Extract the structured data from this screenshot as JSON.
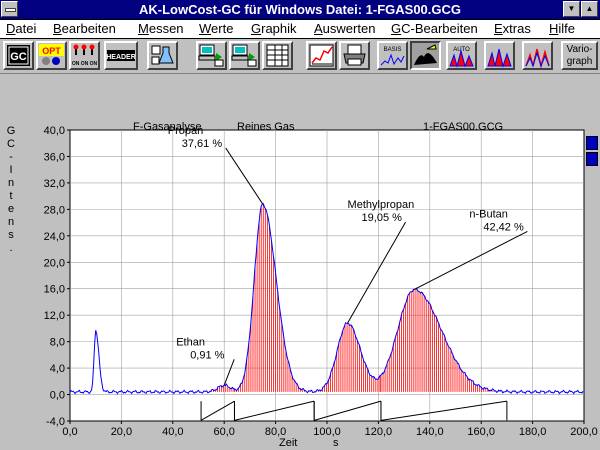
{
  "window": {
    "title": "AK-LowCost-GC für Windows         Datei: 1-FGAS00.GCG",
    "minimize_glyph": "▼",
    "maximize_glyph": "▲"
  },
  "menu": [
    {
      "u": "D",
      "rest": "atei"
    },
    {
      "u": "B",
      "rest": "earbeiten"
    },
    {
      "u": "M",
      "rest": "essen"
    },
    {
      "u": "W",
      "rest": "erte"
    },
    {
      "u": "G",
      "rest": "raphik"
    },
    {
      "u": "A",
      "rest": "uswerten"
    },
    {
      "u": "G",
      "rest": "C-Bearbeiten"
    },
    {
      "u": "E",
      "rest": "xtras"
    },
    {
      "u": "H",
      "rest": "ilfe"
    }
  ],
  "toolbar": {
    "gc_label": "GC",
    "opt_label": "OPT",
    "onoff_label": "ON ON ON",
    "header_label": "HEADER",
    "basis_label": "BASIS",
    "auto_label": "AUTO",
    "vario_label_1": "Vario-",
    "vario_label_2": "graph"
  },
  "chart_data": {
    "type": "line",
    "header_left": "F-Gasanalyse",
    "header_mid": "Reines Gas",
    "header_right": "1-FGAS00.GCG",
    "ylabel_chars": [
      "G",
      "C",
      "-",
      "I",
      "n",
      "t",
      "e",
      "n",
      "s",
      "."
    ],
    "xlabel": "Zeit",
    "xunit": "s",
    "xlim": [
      0,
      200
    ],
    "ylim": [
      -4,
      40
    ],
    "xticks": [
      0,
      20,
      40,
      60,
      80,
      100,
      120,
      140,
      160,
      180,
      200
    ],
    "xtick_labels": [
      "0,0",
      "20,0",
      "40,0",
      "60,0",
      "80,0",
      "100,0",
      "120,0",
      "140,0",
      "160,0",
      "180,0",
      "200,0"
    ],
    "yticks": [
      -4,
      0,
      4,
      8,
      12,
      16,
      20,
      24,
      28,
      32,
      36,
      40
    ],
    "ytick_labels": [
      "-4,0",
      "0,0",
      "4,0",
      "8,0",
      "12,0",
      "16,0",
      "20,0",
      "24,0",
      "28,0",
      "32,0",
      "36,0",
      "40,0"
    ],
    "grid": true,
    "baseline": 0.4,
    "trace_color": "#0000ff",
    "fill_color": "#ff0000",
    "peaks": [
      {
        "name": "Ethan",
        "value_text": "0,91 %",
        "x": 60,
        "y": 1.4
      },
      {
        "name": "Propan",
        "value_text": "37,61 %",
        "x": 75,
        "y": 28.8
      },
      {
        "name": "Methylpropan",
        "value_text": "19,05 %",
        "x": 108,
        "y": 10.8
      },
      {
        "name": "n-Butan",
        "value_text": "42,42 %",
        "x": 134,
        "y": 15.9
      }
    ],
    "air_peak": {
      "x": 10,
      "y": 9.8
    },
    "integration_ranges": [
      [
        51,
        64
      ],
      [
        64,
        95
      ],
      [
        95,
        121
      ],
      [
        121,
        170
      ]
    ]
  }
}
